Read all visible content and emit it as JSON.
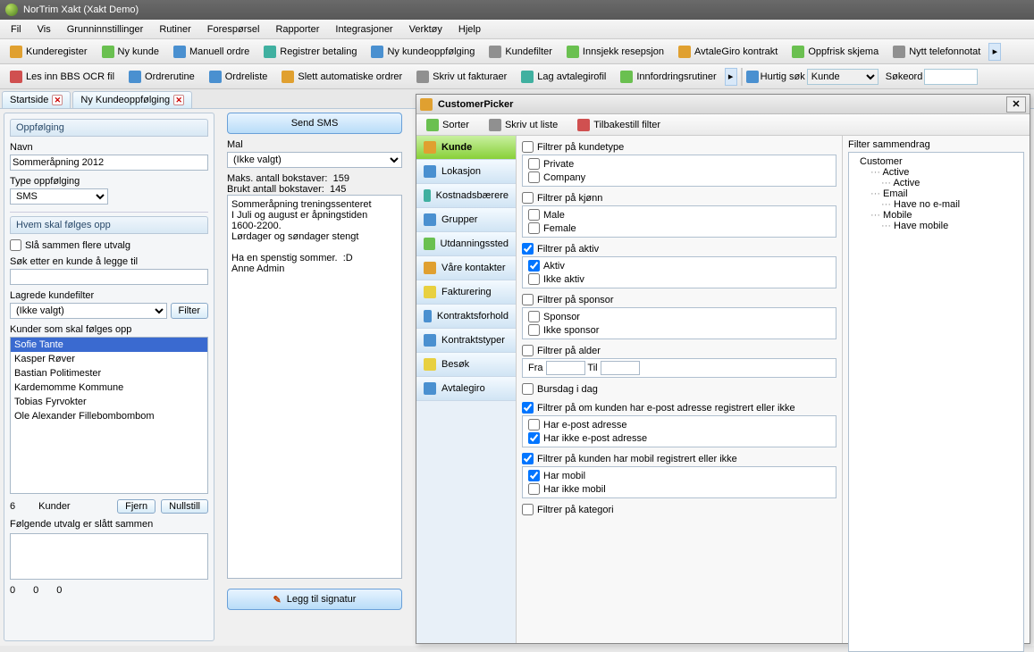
{
  "window": {
    "title": "NorTrim Xakt (Xakt Demo)"
  },
  "menu": [
    "Fil",
    "Vis",
    "Grunninnstillinger",
    "Rutiner",
    "Forespørsel",
    "Rapporter",
    "Integrasjoner",
    "Verktøy",
    "Hjelp"
  ],
  "toolbar1": [
    {
      "label": "Kunderegister",
      "icon": "sq-orange"
    },
    {
      "label": "Ny kunde",
      "icon": "sq-green"
    },
    {
      "label": "Manuell ordre",
      "icon": "sq-blue"
    },
    {
      "label": "Registrer betaling",
      "icon": "sq-teal"
    },
    {
      "label": "Ny kundeoppfølging",
      "icon": "sq-blue"
    },
    {
      "label": "Kundefilter",
      "icon": "sq-gray"
    },
    {
      "label": "Innsjekk resepsjon",
      "icon": "sq-green"
    },
    {
      "label": "AvtaleGiro kontrakt",
      "icon": "sq-orange"
    },
    {
      "label": "Oppfrisk skjema",
      "icon": "sq-green"
    },
    {
      "label": "Nytt telefonnotat",
      "icon": "sq-gray"
    }
  ],
  "toolbar2": [
    {
      "label": "Les inn BBS OCR fil",
      "icon": "sq-red"
    },
    {
      "label": "Ordrerutine",
      "icon": "sq-blue"
    },
    {
      "label": "Ordreliste",
      "icon": "sq-blue"
    },
    {
      "label": "Slett automatiske ordrer",
      "icon": "sq-orange"
    },
    {
      "label": "Skriv ut fakturaer",
      "icon": "sq-gray"
    },
    {
      "label": "Lag avtalegirofil",
      "icon": "sq-teal"
    },
    {
      "label": "Innfordringsrutiner",
      "icon": "sq-green"
    }
  ],
  "quicksearch": {
    "label": "Hurtig søk",
    "select": "Kunde",
    "keyword_label": "Søkeord"
  },
  "tabs": [
    {
      "label": "Startside"
    },
    {
      "label": "Ny Kundeoppfølging"
    }
  ],
  "left": {
    "header": "Oppfølging",
    "name_label": "Navn",
    "name_value": "Sommeråpning 2012",
    "type_label": "Type oppfølging",
    "type_value": "SMS",
    "who_header": "Hvem skal følges opp",
    "merge_label": "Slå sammen flere utvalg",
    "search_label": "Søk etter en kunde å legge til",
    "saved_label": "Lagrede kundefilter",
    "saved_value": "(Ikke valgt)",
    "filter_btn": "Filter",
    "list_label": "Kunder som skal følges opp",
    "customers": [
      "Sofie Tante",
      "Kasper Røver",
      "Bastian Politimester",
      "Kardemomme Kommune",
      "Tobias Fyrvokter",
      "Ole Alexander Fillebombombom"
    ],
    "count": "6",
    "count_label": "Kunder",
    "remove_btn": "Fjern",
    "reset_btn": "Nullstill",
    "merged_label": "Følgende utvalg er slått sammen",
    "zeros": [
      "0",
      "0",
      "0"
    ]
  },
  "mid": {
    "send_btn": "Send SMS",
    "mal_label": "Mal",
    "mal_value": "(Ikke valgt)",
    "max_label": "Maks. antall bokstaver:",
    "max_value": "159",
    "used_label": "Brukt antall bokstaver:",
    "used_value": "145",
    "message": "Sommeråpning treningssenteret\nI Juli og august er åpningstiden\n1600-2200.\nLørdager og søndager stengt\n\nHa en spenstig sommer.  :D\nAnne Admin",
    "sign_btn": "Legg til signatur"
  },
  "picker": {
    "title": "CustomerPicker",
    "tb": [
      {
        "label": "Sorter"
      },
      {
        "label": "Skriv ut liste"
      },
      {
        "label": "Tilbakestill filter"
      }
    ],
    "cats": [
      "Kunde",
      "Lokasjon",
      "Kostnadsbærere",
      "Grupper",
      "Utdanningssted",
      "Våre kontakter",
      "Fakturering",
      "Kontraktsforhold",
      "Kontraktstyper",
      "Besøk",
      "Avtalegiro"
    ],
    "f_type": {
      "head": "Filtrer på kundetype",
      "opts": [
        "Private",
        "Company"
      ]
    },
    "f_gender": {
      "head": "Filtrer på kjønn",
      "opts": [
        "Male",
        "Female"
      ]
    },
    "f_active": {
      "head": "Filtrer på aktiv",
      "opts": [
        "Aktiv",
        "Ikke aktiv"
      ],
      "checked_head": true,
      "checked": [
        true,
        false
      ]
    },
    "f_sponsor": {
      "head": "Filtrer på sponsor",
      "opts": [
        "Sponsor",
        "Ikke sponsor"
      ]
    },
    "f_age": {
      "head": "Filtrer på alder",
      "from": "Fra",
      "to": "Til"
    },
    "f_bday": {
      "head": "Bursdag i dag"
    },
    "f_email": {
      "head": "Filtrer på om kunden har e-post adresse registrert eller ikke",
      "opts": [
        "Har e-post adresse",
        "Har ikke e-post adresse"
      ],
      "checked_head": true,
      "checked": [
        false,
        true
      ]
    },
    "f_mobile": {
      "head": "Filtrer på kunden har mobil registrert eller ikke",
      "opts": [
        "Har mobil",
        "Har ikke mobil"
      ],
      "checked_head": true,
      "checked": [
        true,
        false
      ]
    },
    "f_cat": {
      "head": "Filtrer på kategori"
    },
    "summary": {
      "label": "Filter sammendrag",
      "tree": [
        {
          "lvl": 1,
          "text": "Customer"
        },
        {
          "lvl": 2,
          "text": "Active"
        },
        {
          "lvl": 3,
          "text": "Active"
        },
        {
          "lvl": 2,
          "text": "Email"
        },
        {
          "lvl": 3,
          "text": "Have no e-mail"
        },
        {
          "lvl": 2,
          "text": "Mobile"
        },
        {
          "lvl": 3,
          "text": "Have mobile"
        }
      ]
    }
  }
}
